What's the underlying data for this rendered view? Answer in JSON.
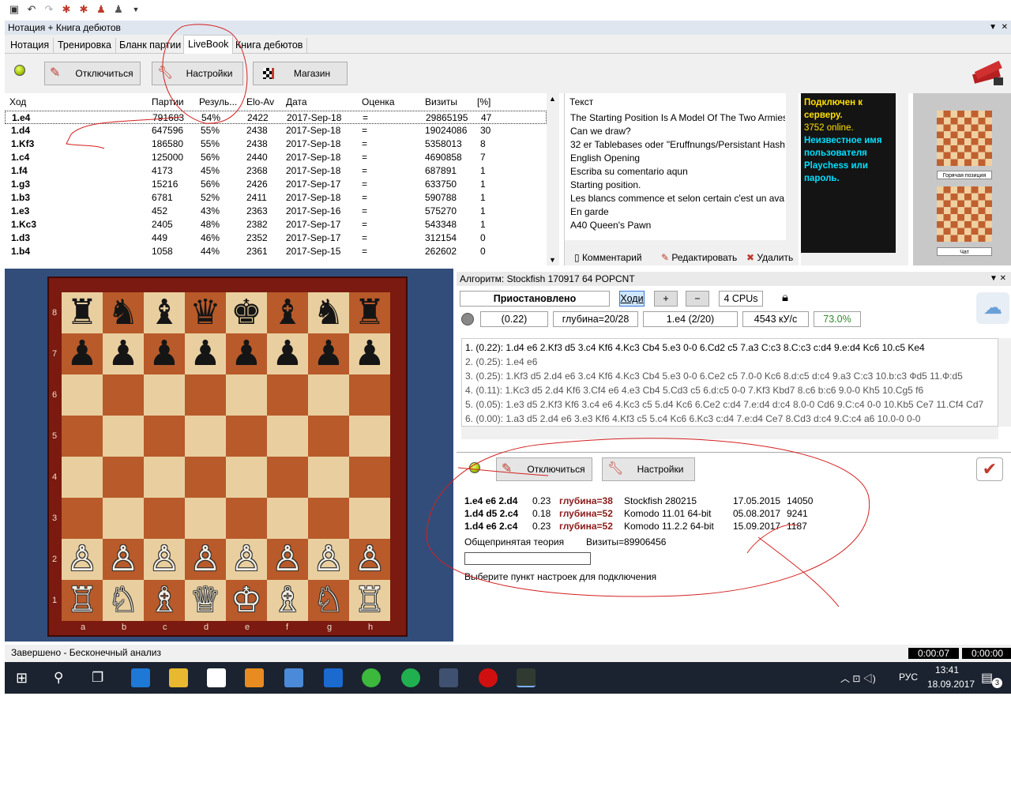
{
  "colors": {
    "accent_red": "#c0392b",
    "chat_yellow": "#ffe000",
    "chat_cyan": "#00e0ff",
    "board_light": "#e9cf9f",
    "board_dark": "#b85a2a",
    "green_value": "#2e8b2e"
  },
  "panel_title": "Нотация + Книга дебютов",
  "tabs": [
    "Нотация",
    "Тренировка",
    "Бланк партии",
    "LiveBook",
    "Книга дебютов"
  ],
  "toolbar": {
    "disconnect": "Отключиться",
    "settings": "Настройки",
    "shop": "Магазин"
  },
  "table": {
    "headers": [
      "Ход",
      "Партии",
      "Резуль...",
      "Elo-Av",
      "Дата",
      "Оценка",
      "Визиты",
      "[%]"
    ],
    "rows": [
      [
        "1.e4",
        "791683",
        "54%",
        "2422",
        "2017-Sep-18",
        "=",
        "29865195",
        "47"
      ],
      [
        "1.d4",
        "647596",
        "55%",
        "2438",
        "2017-Sep-18",
        "=",
        "19024086",
        "30"
      ],
      [
        "1.Kf3",
        "186580",
        "55%",
        "2438",
        "2017-Sep-18",
        "=",
        "5358013",
        "8"
      ],
      [
        "1.c4",
        "125000",
        "56%",
        "2440",
        "2017-Sep-18",
        "=",
        "4690858",
        "7"
      ],
      [
        "1.f4",
        "4173",
        "45%",
        "2368",
        "2017-Sep-18",
        "=",
        "687891",
        "1"
      ],
      [
        "1.g3",
        "15216",
        "56%",
        "2426",
        "2017-Sep-17",
        "=",
        "633750",
        "1"
      ],
      [
        "1.b3",
        "6781",
        "52%",
        "2411",
        "2017-Sep-18",
        "=",
        "590788",
        "1"
      ],
      [
        "1.e3",
        "452",
        "43%",
        "2363",
        "2017-Sep-16",
        "=",
        "575270",
        "1"
      ],
      [
        "1.Kc3",
        "2405",
        "48%",
        "2382",
        "2017-Sep-17",
        "=",
        "543348",
        "1"
      ],
      [
        "1.d3",
        "449",
        "46%",
        "2352",
        "2017-Sep-17",
        "=",
        "312154",
        "0"
      ],
      [
        "1.b4",
        "1058",
        "44%",
        "2361",
        "2017-Sep-15",
        "=",
        "262602",
        "0"
      ]
    ]
  },
  "text_pane": {
    "header": "Текст",
    "lines": [
      "The Starting Position Is A Model Of The Two Armies",
      "Can we draw?",
      "32 er Tablebases oder \"Eruffnungs/Persistant Hash",
      "English Opening",
      "Escriba su comentario aqun",
      "Starting position.",
      "Les blancs commence et selon certain c'est un avan",
      "En garde",
      "A40 Queen's Pawn"
    ],
    "comment": "Комментарий",
    "edit": "Редактировать",
    "delete": "Удалить"
  },
  "chat": {
    "line1": "Подключен к серверу.",
    "line2": "3752 online.",
    "line3": "Неизвестное имя пользователя Playchess или пароль."
  },
  "thumbs": {
    "cap1": "Горячая позиция",
    "cap2": "Чат"
  },
  "board": {
    "files": [
      "a",
      "b",
      "c",
      "d",
      "e",
      "f",
      "g",
      "h"
    ],
    "ranks": [
      "8",
      "7",
      "6",
      "5",
      "4",
      "3",
      "2",
      "1"
    ],
    "position": [
      [
        "♜",
        "♞",
        "♝",
        "♛",
        "♚",
        "♝",
        "♞",
        "♜"
      ],
      [
        "♟",
        "♟",
        "♟",
        "♟",
        "♟",
        "♟",
        "♟",
        "♟"
      ],
      [
        "",
        "",
        "",
        "",
        "",
        "",
        "",
        ""
      ],
      [
        "",
        "",
        "",
        "",
        "",
        "",
        "",
        ""
      ],
      [
        "",
        "",
        "",
        "",
        "",
        "",
        "",
        ""
      ],
      [
        "",
        "",
        "",
        "",
        "",
        "",
        "",
        ""
      ],
      [
        "♙",
        "♙",
        "♙",
        "♙",
        "♙",
        "♙",
        "♙",
        "♙"
      ],
      [
        "♖",
        "♘",
        "♗",
        "♕",
        "♔",
        "♗",
        "♘",
        "♖"
      ]
    ]
  },
  "engine": {
    "title": "Алгоритм: Stockfish 170917 64 POPCNT",
    "status": "Приостановлено",
    "moves_btn": "Ходи",
    "plus": "+",
    "minus": "−",
    "cpus": "4 CPUs",
    "eval": "(0.22)",
    "depth": "глубина=20/28",
    "current": "1.e4 (2/20)",
    "speed": "4543 кУ/с",
    "percent": "73.0%",
    "lines": [
      "1. (0.22): 1.d4 e6 2.Kf3 d5 3.c4 Kf6 4.Kc3 Cb4 5.e3 0-0 6.Cd2 c5 7.a3 C:c3 8.C:c3 c:d4 9.e:d4 Kc6 10.c5 Ke4",
      "2. (0.25): 1.e4 e6",
      "3. (0.25): 1.Kf3 d5 2.d4 e6 3.c4 Kf6 4.Kc3 Cb4 5.e3 0-0 6.Ce2 c5 7.0-0 Kc6 8.d:c5 d:c4 9.a3 C:c3 10.b:c3 Фd5 11.Ф:d5",
      "4. (0.11): 1.Kc3 d5 2.d4 Kf6 3.Cf4 e6 4.e3 Cb4 5.Cd3 c5 6.d:c5 0-0 7.Kf3 Kbd7 8.c6 b:c6 9.0-0 Kh5 10.Cg5 f6",
      "5. (0.05): 1.e3 d5 2.Kf3 Kf6 3.c4 e6 4.Kc3 c5 5.d4 Kc6 6.Ce2 c:d4 7.e:d4 d:c4 8.0-0 Cd6 9.C:c4 0-0 10.Kb5 Ce7 11.Cf4 Cd7",
      "6. (0.00): 1.a3 d5 2.d4 e6 3.e3 Kf6 4.Kf3 c5 5.c4 Kc6 6.Kc3 c:d4 7.e:d4 Ce7 8.Cd3 d:c4 9.C:c4 a6 10.0-0 0-0"
    ]
  },
  "live": {
    "disconnect": "Отключиться",
    "settings": "Настройки",
    "rows": [
      {
        "line": "1.e4 e6 2.d4",
        "eval": "0.23",
        "depth": "глубина=38",
        "engine": "Stockfish 280215",
        "date": "17.05.2015",
        "visits": "14050"
      },
      {
        "line": "1.d4 d5 2.c4",
        "eval": "0.18",
        "depth": "глубина=52",
        "engine": "Komodo 11.01 64-bit",
        "date": "05.08.2017",
        "visits": "9241"
      },
      {
        "line": "1.d4 e6 2.c4",
        "eval": "0.23",
        "depth": "глубина=52",
        "engine": "Komodo 11.2.2 64-bit",
        "date": "15.09.2017",
        "visits": "1187"
      }
    ],
    "theory": "Общепринятая теория",
    "visits_total": "Визиты=89906456",
    "hint": "Выберите пункт настроек для подключения"
  },
  "status": {
    "text": "Завершено - Бесконечный анализ",
    "timer1": "0:00:07",
    "timer2": "0:00:00"
  },
  "taskbar": {
    "lang": "РУС",
    "time": "13:41",
    "date": "18.09.2017",
    "notif": "3"
  }
}
